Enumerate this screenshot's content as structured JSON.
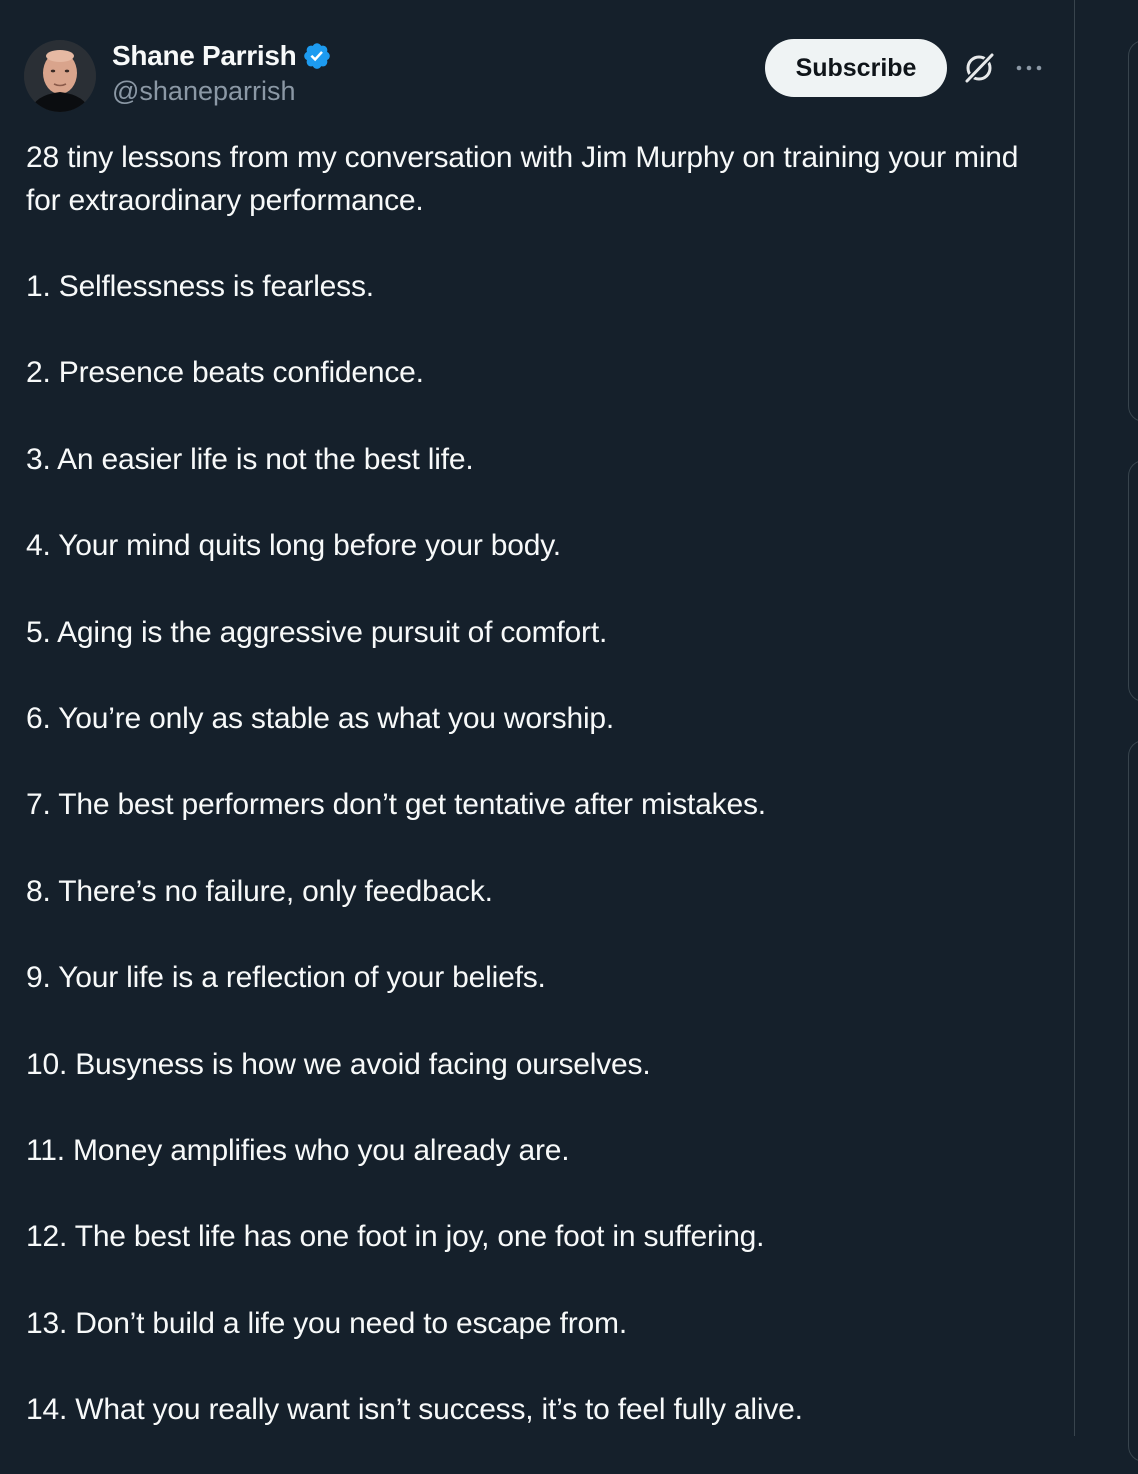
{
  "author": {
    "name": "Shane Parrish",
    "handle": "@shaneparrish",
    "verified_color": "#1d9bf0"
  },
  "actions": {
    "subscribe_label": "Subscribe",
    "grok_icon": "grok-icon",
    "more_icon": "more-icon"
  },
  "tweet": {
    "intro": "28 tiny lessons from my conversation with Jim Murphy on training your mind for extraordinary performance.",
    "lessons": [
      "1. Selflessness is fearless.",
      "2. Presence beats confidence.",
      "3. An easier life is not the best life.",
      "4. Your mind quits long before your body.",
      "5. Aging is the aggressive pursuit of comfort.",
      "6. You’re only as stable as what you worship.",
      "7. The best performers don’t get tentative after mistakes.",
      "8. There’s no failure, only feedback.",
      "9. Your life is a reflection of your beliefs.",
      "10. Busyness is how we avoid facing ourselves.",
      "11. Money amplifies who you already are.",
      "12. The best life has one foot in joy, one foot in suffering.",
      "13. Don’t build a life you need to escape from.",
      "14. What you really want isn’t success, it’s to feel fully alive."
    ]
  },
  "colors": {
    "background": "#15202b",
    "text_primary": "#f7f9f9",
    "text_secondary": "#8b98a5",
    "border": "#38444d",
    "button_bg": "#eff3f4"
  }
}
